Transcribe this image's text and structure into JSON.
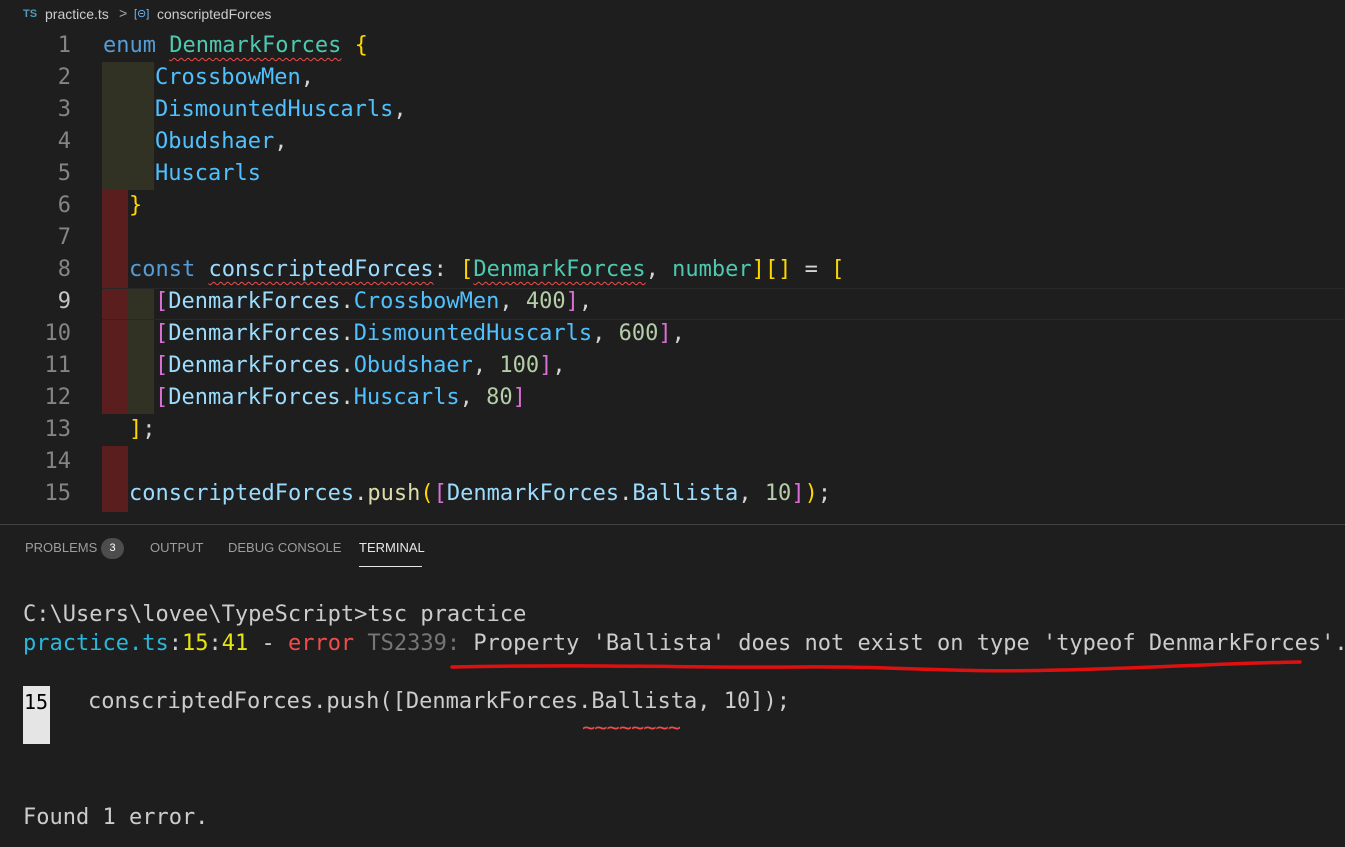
{
  "breadcrumb": {
    "file_icon": "TS",
    "file": "practice.ts",
    "separator": ">",
    "symbol_icon": "[⊝]",
    "symbol": "conscriptedForces"
  },
  "editor": {
    "line_numbers": [
      "1",
      "2",
      "3",
      "4",
      "5",
      "6",
      "7",
      "8",
      "9",
      "10",
      "11",
      "12",
      "13",
      "14",
      "15"
    ],
    "l1": {
      "kw": "enum",
      "name": "DenmarkForces",
      "brace": "{"
    },
    "l2": {
      "member": "CrossbowMen",
      "punc": ","
    },
    "l3": {
      "member": "DismountedHuscarls",
      "punc": ","
    },
    "l4": {
      "member": "Obudshaer",
      "punc": ","
    },
    "l5": {
      "member": "Huscarls"
    },
    "l6": {
      "brace": "}"
    },
    "l8": {
      "kw": "const",
      "var": "conscriptedForces",
      "colon": ": ",
      "open": "[",
      "type1": "DenmarkForces",
      "comma": ", ",
      "type2": "number",
      "close": "]",
      "arr": "[]",
      "eq": " = ",
      "bracket": "["
    },
    "l9": {
      "open": "[",
      "obj": "DenmarkForces",
      "dot": ".",
      "member": "CrossbowMen",
      "sep": ", ",
      "num": "400",
      "close": "]",
      "punc": ","
    },
    "l10": {
      "open": "[",
      "obj": "DenmarkForces",
      "dot": ".",
      "member": "DismountedHuscarls",
      "sep": ", ",
      "num": "600",
      "close": "]",
      "punc": ","
    },
    "l11": {
      "open": "[",
      "obj": "DenmarkForces",
      "dot": ".",
      "member": "Obudshaer",
      "sep": ", ",
      "num": "100",
      "close": "]",
      "punc": ","
    },
    "l12": {
      "open": "[",
      "obj": "DenmarkForces",
      "dot": ".",
      "member": "Huscarls",
      "sep": ", ",
      "num": "80",
      "close": "]"
    },
    "l13": {
      "close": "]",
      "punc": ";"
    },
    "l15": {
      "var": "conscriptedForces",
      "dot": ".",
      "fn": "push",
      "p_open": "(",
      "open": "[",
      "obj": "DenmarkForces",
      "dot2": ".",
      "member": "Ballista",
      "sep": ", ",
      "num": "10",
      "close": "]",
      "p_close": ")",
      "punc": ";"
    }
  },
  "panel": {
    "tabs": {
      "problems": "PROBLEMS",
      "output": "OUTPUT",
      "debug": "DEBUG CONSOLE",
      "terminal": "TERMINAL"
    },
    "problems_count": "3"
  },
  "terminal": {
    "prompt": "C:\\Users\\lovee\\TypeScript>tsc practice",
    "err_file": "practice.ts",
    "err_sep1": ":",
    "err_line": "15",
    "err_sep2": ":",
    "err_col": "41",
    "err_dash": " - ",
    "err_word": "error",
    "err_code": " TS2339: ",
    "err_msg": "Property 'Ballista' does not exist on type 'typeof DenmarkForces'.",
    "src_line_no": "15",
    "src_code": "conscriptedForces.push([DenmarkForces.Ballista, 10]);",
    "tildes": "~~~~~~~~",
    "found": "Found 1 error."
  },
  "colors": {
    "annotation_red": "#e01010",
    "error_red": "#f14c4c",
    "accent": "#29b8db"
  }
}
